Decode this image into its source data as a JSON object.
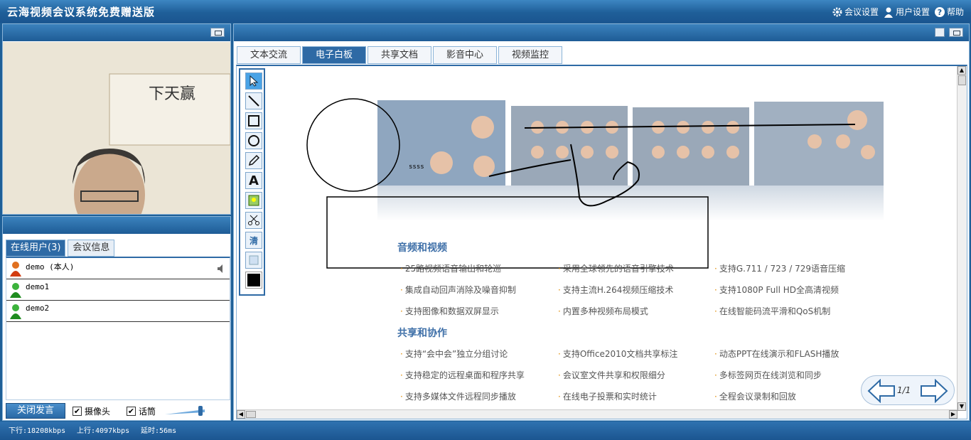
{
  "app": {
    "title": "云海视频会议系统免费赠送版"
  },
  "topmenu": {
    "meeting_settings": "会议设置",
    "user_settings": "用户设置",
    "help": "帮助"
  },
  "left_tabs": {
    "online_users": "在线用户(3)",
    "meeting_info": "会议信息"
  },
  "users": [
    {
      "name": "demo  (本人)",
      "icon": "user-orange-icon",
      "speaker": true
    },
    {
      "name": "demo1",
      "icon": "user-green-icon",
      "speaker": false
    },
    {
      "name": "demo2",
      "icon": "user-green-icon",
      "speaker": false
    }
  ],
  "controls": {
    "speak_button": "关闭发言",
    "camera_label": "摄像头",
    "camera_checked": true,
    "mic_label": "话筒",
    "mic_checked": true,
    "volume_level": 0.85
  },
  "main_tabs": [
    {
      "label": "文本交流",
      "active": false
    },
    {
      "label": "电子白板",
      "active": true
    },
    {
      "label": "共享文档",
      "active": false
    },
    {
      "label": "影音中心",
      "active": false
    },
    {
      "label": "视频监控",
      "active": false
    }
  ],
  "whiteboard_tools": [
    "select-arrow-icon",
    "line-tool-icon",
    "rectangle-tool-icon",
    "circle-tool-icon",
    "pencil-tool-icon",
    "text-tool-icon",
    "image-tool-icon",
    "scissors-tool-icon",
    "clear-tool-icon",
    "eraser-tool-icon",
    "color-picker-icon"
  ],
  "tool_labels": {
    "text": "A",
    "clear": "清"
  },
  "board_annotation": "ssss",
  "content": {
    "section1": "音频和视频",
    "section1_items": [
      "25路视频语音输出和轮巡",
      "采用全球领先的语音引擎技术",
      "支持G.711 / 723 / 729语音压缩",
      "集成自动回声消除及噪音抑制",
      "支持主流H.264视频压缩技术",
      "支持1080P Full HD全高清视频",
      "支持图像和数据双屏显示",
      "内置多种视频布局模式",
      "在线智能码流平滑和QoS机制"
    ],
    "section2": "共享和协作",
    "section2_items": [
      "支持“会中会”独立分组讨论",
      "支持Office2010文档共享标注",
      "动态PPT在线演示和FLASH播放",
      "支持稳定的远程桌面和程序共享",
      "会议室文件共享和权限细分",
      "多标签网页在线浏览和同步",
      "支持多媒体文件远程同步播放",
      "在线电子投票和实时统计",
      "全程会议录制和回放"
    ]
  },
  "pager": {
    "label": "1/1"
  },
  "status": {
    "down": "下行:18208kbps",
    "up": "上行:4097kbps",
    "delay": "延时:56ms"
  },
  "colors": {
    "accent": "#2e6aa5",
    "title_bar": "#1f5f99",
    "section_title": "#3e6fa8",
    "bullet": "#e08a00"
  }
}
